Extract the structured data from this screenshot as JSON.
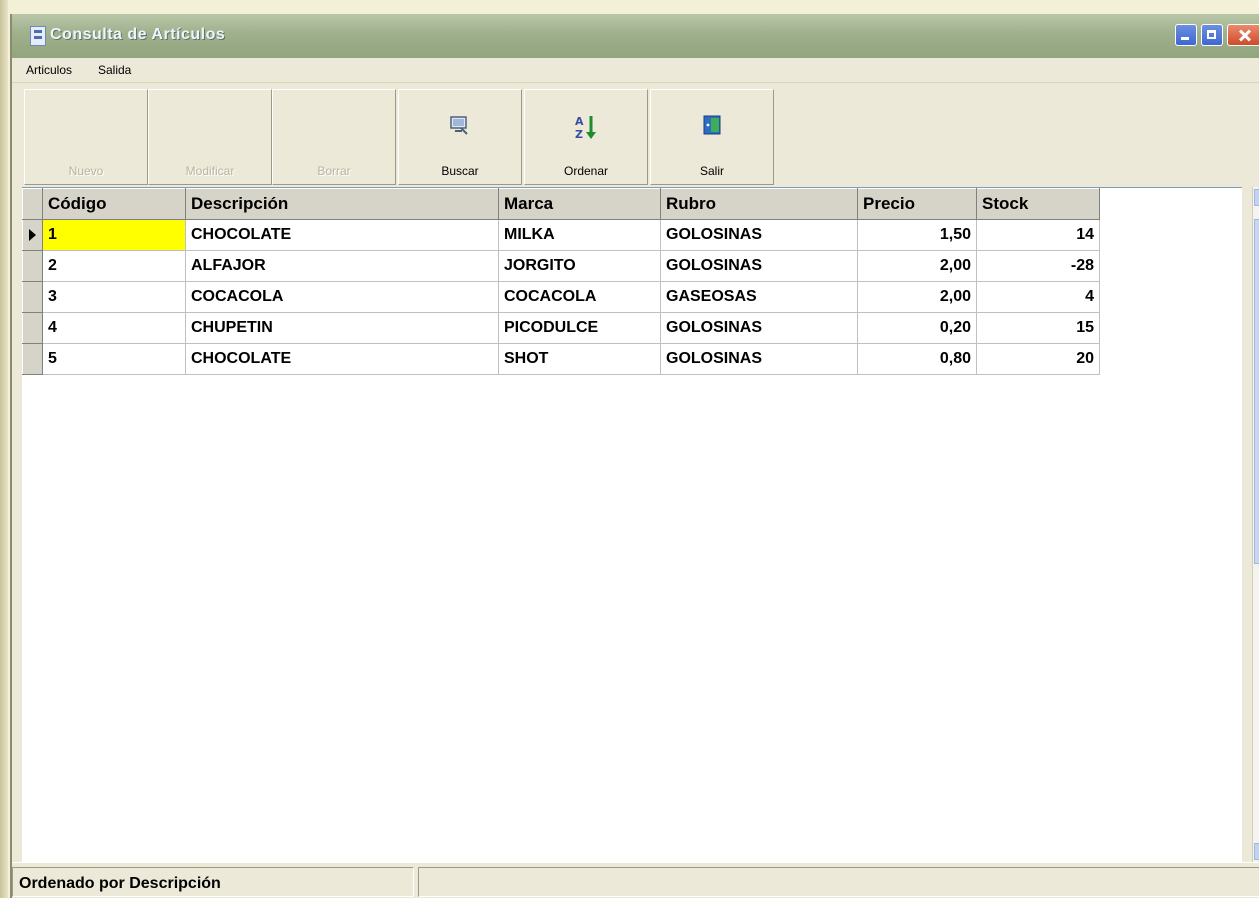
{
  "window": {
    "title": "Consulta de Artículos"
  },
  "menu": {
    "items": [
      "Articulos",
      "Salida"
    ]
  },
  "toolbar": {
    "buttons": [
      {
        "label": "Nuevo",
        "enabled": false,
        "icon": ""
      },
      {
        "label": "Modificar",
        "enabled": false,
        "icon": ""
      },
      {
        "label": "Borrar",
        "enabled": false,
        "icon": ""
      },
      {
        "label": "Buscar",
        "enabled": true,
        "icon": "search-icon"
      },
      {
        "label": "Ordenar",
        "enabled": true,
        "icon": "sort-az-icon"
      },
      {
        "label": "Salir",
        "enabled": true,
        "icon": "exit-icon"
      }
    ]
  },
  "grid": {
    "columns": [
      "Código",
      "Descripción",
      "Marca",
      "Rubro",
      "Precio",
      "Stock"
    ],
    "rows": [
      {
        "codigo": "1",
        "descripcion": "CHOCOLATE",
        "marca": "MILKA",
        "rubro": "GOLOSINAS",
        "precio": "1,50",
        "stock": "14"
      },
      {
        "codigo": "2",
        "descripcion": "ALFAJOR",
        "marca": "JORGITO",
        "rubro": "GOLOSINAS",
        "precio": "2,00",
        "stock": "-28"
      },
      {
        "codigo": "3",
        "descripcion": "COCACOLA",
        "marca": "COCACOLA",
        "rubro": "GASEOSAS",
        "precio": "2,00",
        "stock": "4"
      },
      {
        "codigo": "4",
        "descripcion": "CHUPETIN",
        "marca": "PICODULCE",
        "rubro": "GOLOSINAS",
        "precio": "0,20",
        "stock": "15"
      },
      {
        "codigo": "5",
        "descripcion": "CHOCOLATE",
        "marca": "SHOT",
        "rubro": "GOLOSINAS",
        "precio": "0,80",
        "stock": "20"
      }
    ],
    "selected_row": 0,
    "selected_color": "#ffff00"
  },
  "status": {
    "text": "Ordenado por Descripción"
  }
}
